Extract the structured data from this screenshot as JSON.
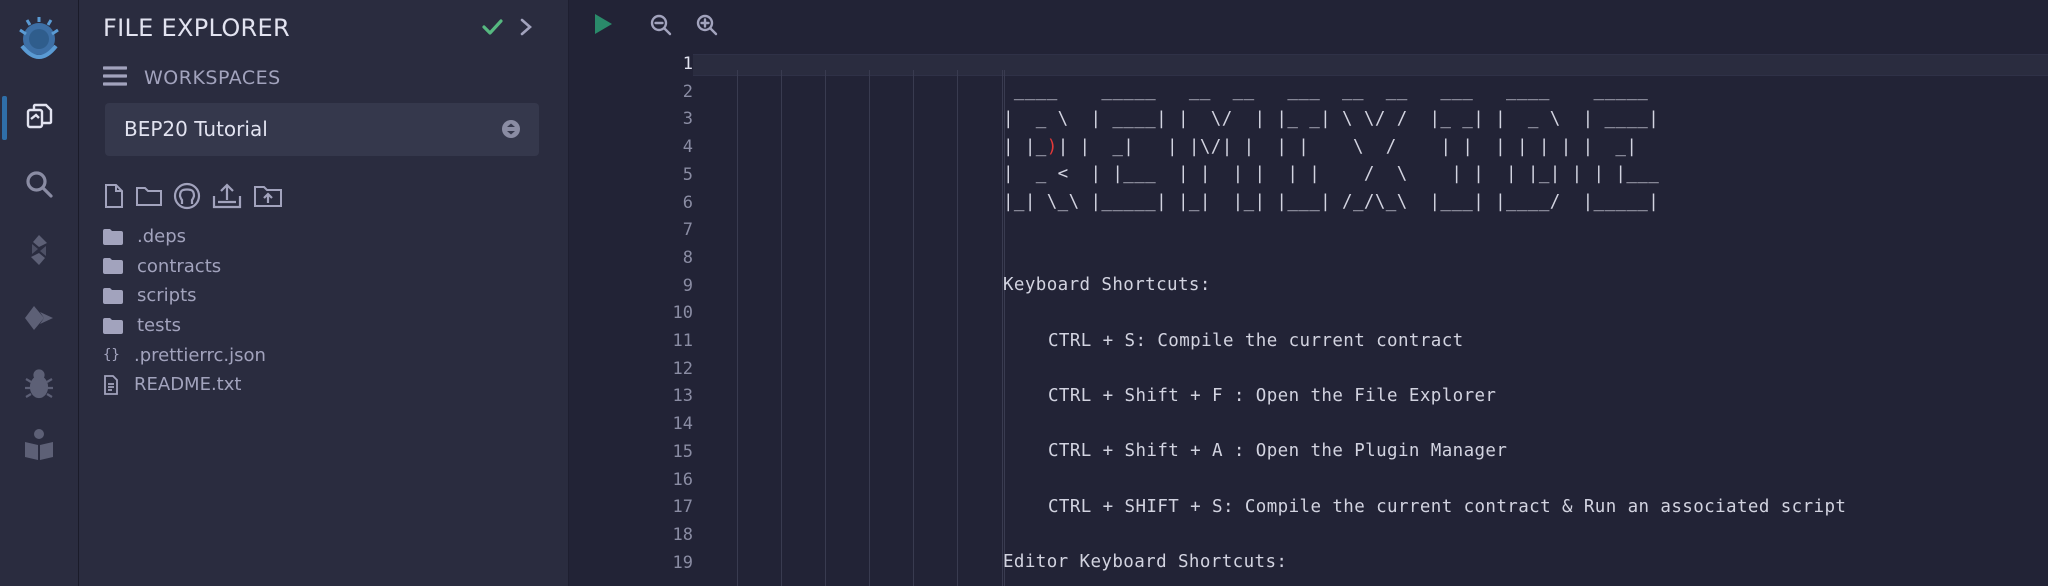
{
  "rail": {
    "items": [
      {
        "name": "remix-logo-icon"
      },
      {
        "name": "file-explorer-icon"
      },
      {
        "name": "search-icon"
      },
      {
        "name": "solidity-compiler-icon"
      },
      {
        "name": "deploy-run-icon"
      },
      {
        "name": "debugger-icon"
      },
      {
        "name": "learneth-icon"
      }
    ]
  },
  "panel": {
    "title": "FILE EXPLORER",
    "workspaces_label": "WORKSPACES",
    "workspace_selected": "BEP20 Tutorial",
    "tree": [
      {
        "type": "folder",
        "label": ".deps"
      },
      {
        "type": "folder",
        "label": "contracts"
      },
      {
        "type": "folder",
        "label": "scripts"
      },
      {
        "type": "folder",
        "label": "tests"
      },
      {
        "type": "json",
        "label": ".prettierrc.json"
      },
      {
        "type": "file",
        "label": "README.txt"
      }
    ]
  },
  "toolbar": {
    "run": "run-icon",
    "zoom_out": "zoom-out-icon",
    "zoom_in": "zoom-in-icon"
  },
  "editor": {
    "line_numbers": [
      "1",
      "2",
      "3",
      "4",
      "5",
      "6",
      "7",
      "8",
      "9",
      "10",
      "11",
      "12",
      "13",
      "14",
      "15",
      "16",
      "17",
      "18",
      "19"
    ],
    "active_line": "1",
    "ascii": [
      " ____    _____   __  __   ___  __  __   ___   ____    _____",
      "|  _ \\  | ____| |  \\/  | |_ _| \\ \\/ /  |_ _| |  _ \\  | ____|",
      "| |_",
      "| |  _|   | |\\/| |  | |    \\  /    | |  | | | | |  _|",
      "|  _ <  | |___  | |  | |  | |    /  \\    | |  | |_| | | |___",
      "|_| \\_\\ |_____| |_|  |_| |___| /_/\\_\\  |___| |____/  |_____|"
    ],
    "ascii_red": ")",
    "shortcuts_title": "Keyboard Shortcuts:",
    "shortcuts": [
      "CTRL + S: Compile the current contract",
      "CTRL + Shift + F : Open the File Explorer",
      "CTRL + Shift + A : Open the Plugin Manager",
      "CTRL + SHIFT + S: Compile the current contract & Run an associated script"
    ],
    "editor_shortcuts_title": "Editor Keyboard Shortcuts:"
  },
  "colors": {
    "accent": "#2f6ea8",
    "check": "#56b880",
    "run": "#2a8a6a"
  }
}
